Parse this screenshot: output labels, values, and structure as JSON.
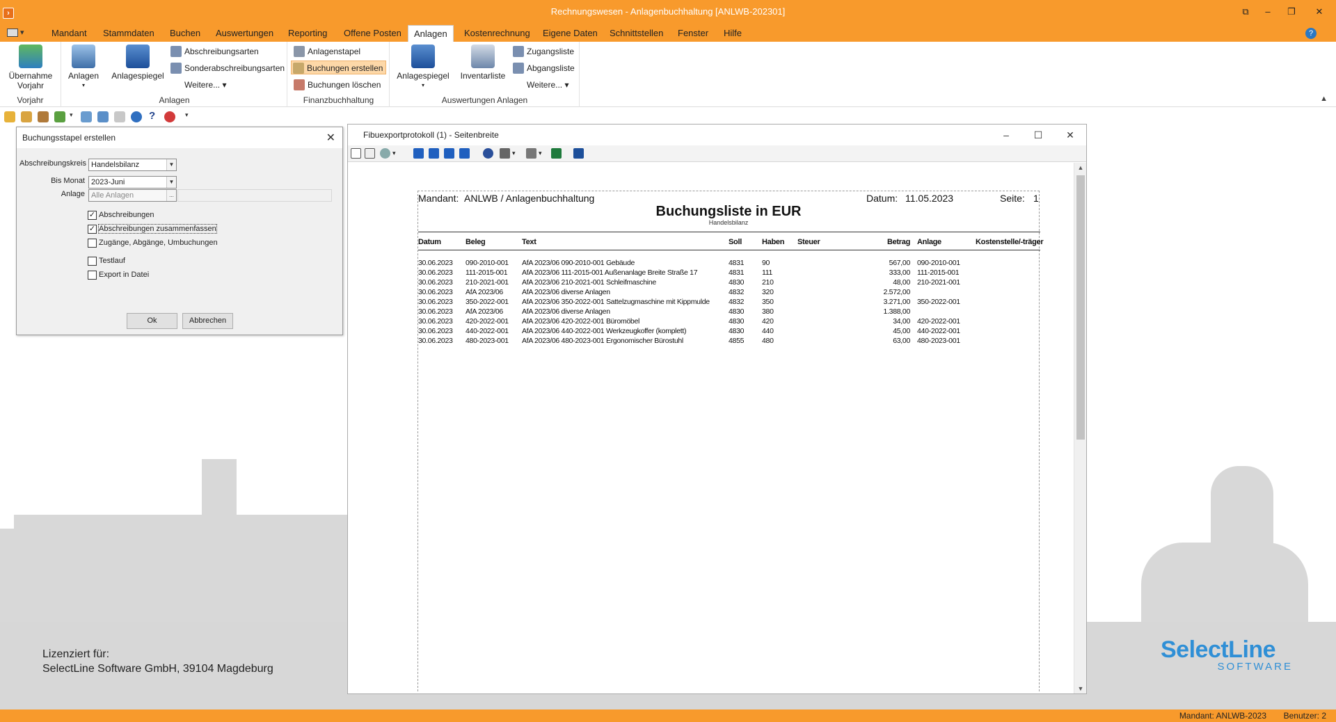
{
  "window": {
    "title": "Rechnungswesen - Anlagenbuchhaltung [ANLWB-202301]"
  },
  "menu": [
    "Mandant",
    "Stammdaten",
    "Buchen",
    "Auswertungen",
    "Reporting",
    "Offene Posten",
    "Anlagen",
    "Kostenrechnung",
    "Eigene Daten",
    "Schnittstellen",
    "Fenster",
    "Hilfe"
  ],
  "menu_active": "Anlagen",
  "ribbon": {
    "vorjahr": {
      "btn_line1": "Übernahme",
      "btn_line2": "Vorjahr",
      "group": "Vorjahr"
    },
    "anlagen": {
      "anlagen": "Anlagen",
      "anlagespiegel": "Anlagespiegel",
      "abschreibungsarten": "Abschreibungsarten",
      "sonderabschreibungsarten": "Sonderabschreibungsarten",
      "weitere": "Weitere...",
      "group": "Anlagen"
    },
    "finanz": {
      "anlagenstapel": "Anlagenstapel",
      "buchungen_erstellen": "Buchungen erstellen",
      "buchungen_loeschen": "Buchungen löschen",
      "group": "Finanzbuchhaltung"
    },
    "auswertungen": {
      "anlagespiegel": "Anlagespiegel",
      "inventarliste": "Inventarliste",
      "zugangsliste": "Zugangsliste",
      "abgangsliste": "Abgangsliste",
      "weitere": "Weitere...",
      "group": "Auswertungen Anlagen"
    }
  },
  "dialog": {
    "title": "Buchungsstapel erstellen",
    "abschreibungskreis_label": "Abschreibungskreis",
    "abschreibungskreis_value": "Handelsbilanz",
    "bis_monat_label": "Bis Monat",
    "bis_monat_value": "2023-Juni",
    "anlage_label": "Anlage",
    "anlage_value": "Alle Anlagen",
    "checkboxes": [
      {
        "label": "Abschreibungen",
        "checked": true
      },
      {
        "label": "Abschreibungen zusammenfassen",
        "checked": true
      },
      {
        "label": "Zugänge, Abgänge, Umbuchungen",
        "checked": false
      },
      {
        "label": "Testlauf",
        "checked": false
      },
      {
        "label": "Export in Datei",
        "checked": false
      }
    ],
    "ok": "Ok",
    "cancel": "Abbrechen"
  },
  "report_window": {
    "title": "Fibuexportprotokoll (1) - Seitenbreite"
  },
  "report": {
    "mandant_label": "Mandant:",
    "mandant_value": "ANLWB  /  Anlagenbuchhaltung",
    "datum_label": "Datum:",
    "datum_value": "11.05.2023",
    "seite_label": "Seite:",
    "seite_value": "1",
    "title": "Buchungsliste in EUR",
    "subtitle": "Handelsbilanz",
    "columns": [
      "Datum",
      "Beleg",
      "Text",
      "Soll",
      "Haben",
      "Steuer",
      "Betrag",
      "Anlage",
      "Kostenstelle/-träger"
    ],
    "rows": [
      [
        "30.06.2023",
        "090-2010-001",
        "AfA 2023/06 090-2010-001 Gebäude",
        "4831",
        "90",
        "",
        "567,00",
        "090-2010-001"
      ],
      [
        "30.06.2023",
        "111-2015-001",
        "AfA 2023/06 111-2015-001 Außenanlage Breite Straße 17",
        "4831",
        "111",
        "",
        "333,00",
        "111-2015-001"
      ],
      [
        "30.06.2023",
        "210-2021-001",
        "AfA 2023/06 210-2021-001 Schleifmaschine",
        "4830",
        "210",
        "",
        "48,00",
        "210-2021-001"
      ],
      [
        "30.06.2023",
        "AfA 2023/06",
        "AfA 2023/06 diverse Anlagen",
        "4832",
        "320",
        "",
        "2.572,00",
        ""
      ],
      [
        "30.06.2023",
        "350-2022-001",
        "AfA 2023/06 350-2022-001 Sattelzugmaschine mit Kippmulde",
        "4832",
        "350",
        "",
        "3.271,00",
        "350-2022-001"
      ],
      [
        "30.06.2023",
        "AfA 2023/06",
        "AfA 2023/06 diverse Anlagen",
        "4830",
        "380",
        "",
        "1.388,00",
        ""
      ],
      [
        "30.06.2023",
        "420-2022-001",
        "AfA 2023/06 420-2022-001 Büromöbel",
        "4830",
        "420",
        "",
        "34,00",
        "420-2022-001"
      ],
      [
        "30.06.2023",
        "440-2022-001",
        "AfA 2023/06 440-2022-001 Werkzeugkoffer (komplett)",
        "4830",
        "440",
        "",
        "45,00",
        "440-2022-001"
      ],
      [
        "30.06.2023",
        "480-2023-001",
        "AfA 2023/06 480-2023-001 Ergonomischer Bürostuhl",
        "4855",
        "480",
        "",
        "63,00",
        "480-2023-001"
      ]
    ]
  },
  "license": {
    "line1": "Lizenziert für:",
    "line2": "SelectLine Software GmbH, 39104 Magdeburg"
  },
  "logo": {
    "name": "SelectLine",
    "sub": "SOFTWARE"
  },
  "status": {
    "mandant": "Mandant: ANLWB-2023",
    "benutzer": "Benutzer: 2"
  },
  "colors": {
    "accent": "#f89a2c",
    "brand_blue": "#2f8fd6"
  }
}
